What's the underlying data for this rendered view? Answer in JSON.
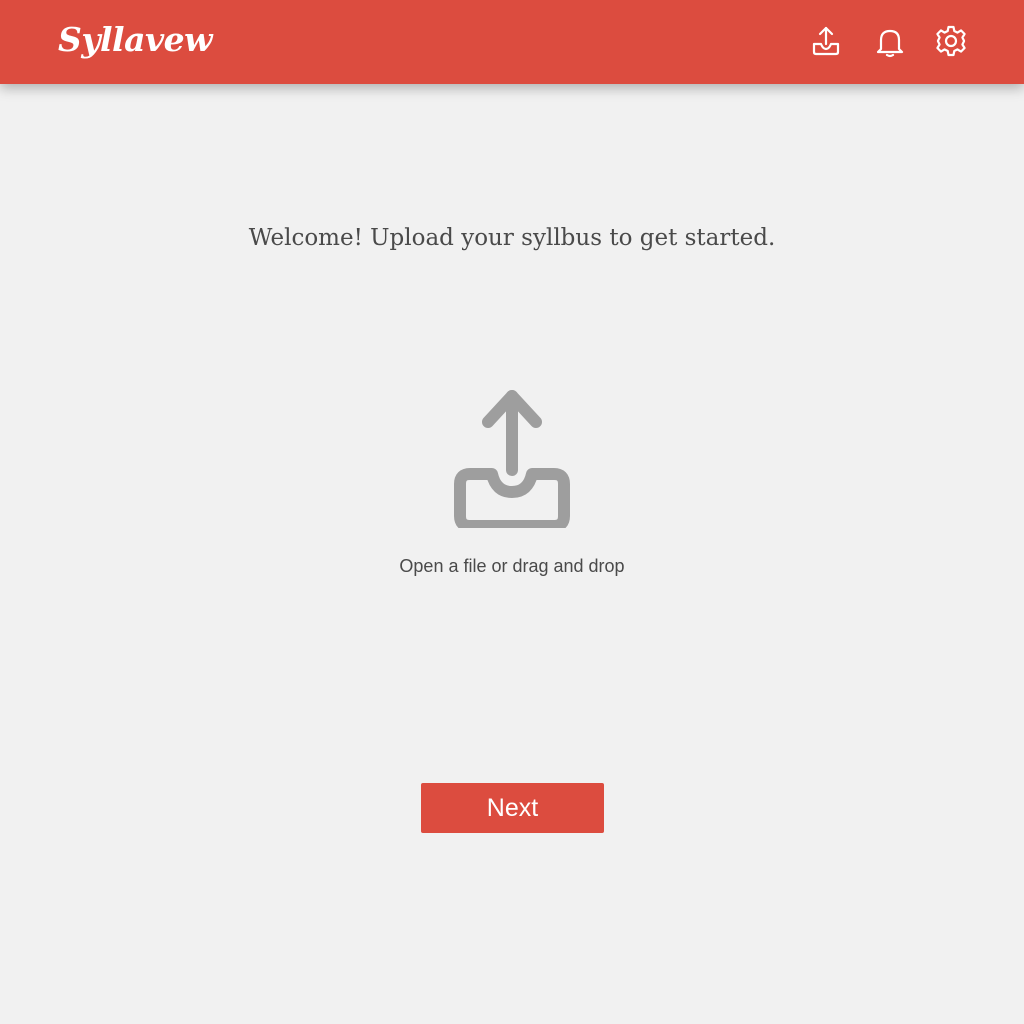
{
  "header": {
    "app_name": "Syllavew",
    "background_color": "#dc4c3f",
    "icons": [
      "upload-icon",
      "bell-icon",
      "gear-icon"
    ]
  },
  "main": {
    "welcome_text": "Welcome! Upload your syllbus to get started.",
    "dropzone": {
      "icon": "upload-icon",
      "label": "Open a file or drag and drop"
    },
    "next_button_label": "Next"
  },
  "colors": {
    "accent": "#dc4c3f",
    "page_background": "#f1f1f1",
    "text": "#4a4a4a",
    "icon_gray": "#9e9e9e"
  }
}
